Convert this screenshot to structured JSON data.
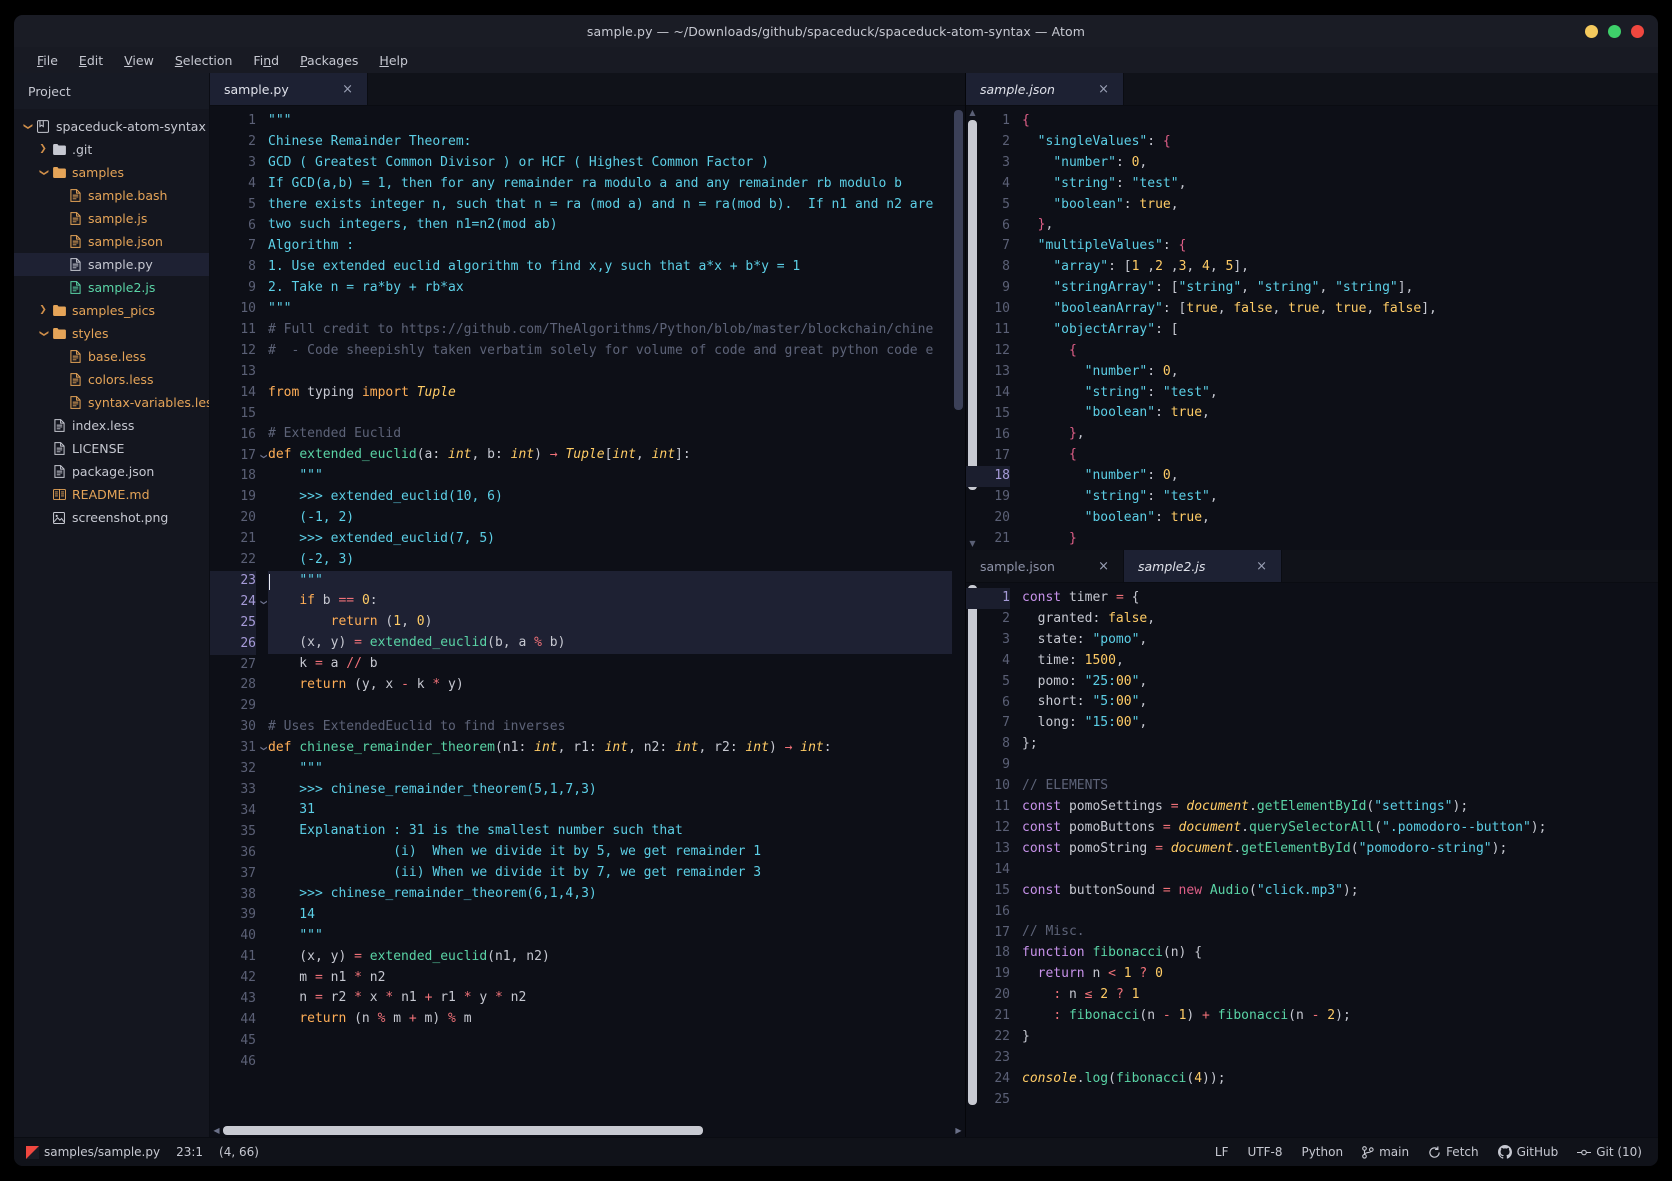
{
  "window": {
    "title": "sample.py — ~/Downloads/github/spaceduck/spaceduck-atom-syntax — Atom",
    "controls": {
      "minimize": "minimize",
      "maximize": "maximize",
      "close": "close"
    }
  },
  "menubar": {
    "items": [
      {
        "label": "File",
        "mnemonic": "F"
      },
      {
        "label": "Edit",
        "mnemonic": "E"
      },
      {
        "label": "View",
        "mnemonic": "V"
      },
      {
        "label": "Selection",
        "mnemonic": "S"
      },
      {
        "label": "Find",
        "mnemonic": "n"
      },
      {
        "label": "Packages",
        "mnemonic": "P"
      },
      {
        "label": "Help",
        "mnemonic": "H"
      }
    ]
  },
  "sidebar": {
    "header": "Project",
    "tree": [
      {
        "label": "spaceduck-atom-syntax",
        "depth": 0,
        "twisty": "v",
        "icon": "repo-icon",
        "color": "white",
        "selected": false
      },
      {
        "label": ".git",
        "depth": 1,
        "twisty": ">",
        "icon": "folder-icon",
        "color": "white",
        "selected": false
      },
      {
        "label": "samples",
        "depth": 1,
        "twisty": "v",
        "icon": "folder-icon",
        "color": "orange",
        "selected": false
      },
      {
        "label": "sample.bash",
        "depth": 2,
        "twisty": "",
        "icon": "file-icon",
        "color": "orange",
        "selected": false
      },
      {
        "label": "sample.js",
        "depth": 2,
        "twisty": "",
        "icon": "file-icon",
        "color": "orange",
        "selected": false
      },
      {
        "label": "sample.json",
        "depth": 2,
        "twisty": "",
        "icon": "file-icon",
        "color": "orange",
        "selected": false
      },
      {
        "label": "sample.py",
        "depth": 2,
        "twisty": "",
        "icon": "file-icon",
        "color": "white",
        "selected": true
      },
      {
        "label": "sample2.js",
        "depth": 2,
        "twisty": "",
        "icon": "file-icon",
        "color": "green",
        "selected": false
      },
      {
        "label": "samples_pics",
        "depth": 1,
        "twisty": ">",
        "icon": "folder-icon",
        "color": "orange",
        "selected": false
      },
      {
        "label": "styles",
        "depth": 1,
        "twisty": "v",
        "icon": "folder-icon",
        "color": "orange",
        "selected": false
      },
      {
        "label": "base.less",
        "depth": 2,
        "twisty": "",
        "icon": "file-icon",
        "color": "orange",
        "selected": false
      },
      {
        "label": "colors.less",
        "depth": 2,
        "twisty": "",
        "icon": "file-icon",
        "color": "orange",
        "selected": false
      },
      {
        "label": "syntax-variables.less",
        "depth": 2,
        "twisty": "",
        "icon": "file-icon",
        "color": "orange",
        "selected": false
      },
      {
        "label": "index.less",
        "depth": 1,
        "twisty": "",
        "icon": "file-icon",
        "color": "white",
        "selected": false
      },
      {
        "label": "LICENSE",
        "depth": 1,
        "twisty": "",
        "icon": "file-icon",
        "color": "white",
        "selected": false
      },
      {
        "label": "package.json",
        "depth": 1,
        "twisty": "",
        "icon": "file-icon",
        "color": "white",
        "selected": false
      },
      {
        "label": "README.md",
        "depth": 1,
        "twisty": "",
        "icon": "book-icon",
        "color": "orange",
        "selected": false
      },
      {
        "label": "screenshot.png",
        "depth": 1,
        "twisty": "",
        "icon": "image-icon",
        "color": "white",
        "selected": false
      }
    ]
  },
  "panes": {
    "left": {
      "tabs": [
        {
          "label": "sample.py",
          "active": true,
          "italic": false,
          "close": "×"
        }
      ],
      "first_line": 1,
      "lines": [
        "\"\"\"",
        "Chinese Remainder Theorem:",
        "GCD ( Greatest Common Divisor ) or HCF ( Highest Common Factor )",
        "If GCD(a,b) = 1, then for any remainder ra modulo a and any remainder rb modulo b",
        "there exists integer n, such that n = ra (mod a) and n = ra(mod b).  If n1 and n2 are",
        "two such integers, then n1=n2(mod ab)",
        "Algorithm :",
        "1. Use extended euclid algorithm to find x,y such that a*x + b*y = 1",
        "2. Take n = ra*by + rb*ax",
        "\"\"\"",
        "# Full credit to https://github.com/TheAlgorithms/Python/blob/master/blockchain/chine",
        "#  - Code sheepishly taken verbatim solely for volume of code and great python code e",
        "",
        "from typing import Tuple",
        "",
        "# Extended Euclid",
        "def extended_euclid(a: int, b: int) -> Tuple[int, int]:",
        "    \"\"\"",
        "    >>> extended_euclid(10, 6)",
        "    (-1, 2)",
        "    >>> extended_euclid(7, 5)",
        "    (-2, 3)",
        "    \"\"\"",
        "    if b == 0:",
        "        return (1, 0)",
        "    (x, y) = extended_euclid(b, a % b)",
        "    k = a // b",
        "    return (y, x - k * y)",
        "",
        "# Uses ExtendedEuclid to find inverses",
        "def chinese_remainder_theorem(n1: int, r1: int, n2: int, r2: int) -> int:",
        "    \"\"\"",
        "    >>> chinese_remainder_theorem(5,1,7,3)",
        "    31",
        "    Explanation : 31 is the smallest number such that",
        "                (i)  When we divide it by 5, we get remainder 1",
        "                (ii) When we divide it by 7, we get remainder 3",
        "    >>> chinese_remainder_theorem(6,1,4,3)",
        "    14",
        "    \"\"\"",
        "    (x, y) = extended_euclid(n1, n2)",
        "    m = n1 * n2",
        "    n = r2 * x * n1 + r1 * y * n2",
        "    return (n % m + m) % m",
        "",
        ""
      ],
      "selected_lines": [
        23,
        24,
        25,
        26
      ],
      "fold_lines": [
        17,
        24,
        31
      ]
    },
    "right_top": {
      "tabs": [
        {
          "label": "sample.json",
          "active": true,
          "italic": true,
          "close": "×"
        }
      ],
      "active_line": 18,
      "lines": [
        "{",
        "  \"singleValues\": {",
        "    \"number\": 0,",
        "    \"string\": \"test\",",
        "    \"boolean\": true,",
        "  },",
        "  \"multipleValues\": {",
        "    \"array\": [1 ,2 ,3, 4, 5],",
        "    \"stringArray\": [\"string\", \"string\", \"string\"],",
        "    \"booleanArray\": [true, false, true, true, false],",
        "    \"objectArray\": [",
        "      {",
        "        \"number\": 0,",
        "        \"string\": \"test\",",
        "        \"boolean\": true,",
        "      },",
        "      {",
        "        \"number\": 0,",
        "        \"string\": \"test\",",
        "        \"boolean\": true,",
        "      }"
      ]
    },
    "right_bottom": {
      "tabs": [
        {
          "label": "sample.json",
          "active": false,
          "italic": false,
          "close": "×"
        },
        {
          "label": "sample2.js",
          "active": true,
          "italic": true,
          "close": "×"
        }
      ],
      "active_line": 1,
      "lines": [
        "const timer = {",
        "  granted: false,",
        "  state: \"pomo\",",
        "  time: 1500,",
        "  pomo: \"25:00\",",
        "  short: \"5:00\",",
        "  long: \"15:00\",",
        "};",
        "",
        "// ELEMENTS",
        "const pomoSettings = document.getElementById(\"settings\");",
        "const pomoButtons = document.querySelectorAll(\".pomodoro--button\");",
        "const pomoString = document.getElementById(\"pomodoro-string\");",
        "",
        "const buttonSound = new Audio(\"click.mp3\");",
        "",
        "// Misc.",
        "function fibonacci(n) {",
        "  return n < 1 ? 0",
        "    : n <= 2 ? 1",
        "    : fibonacci(n - 1) + fibonacci(n - 2);",
        "}",
        "",
        "console.log(fibonacci(4));",
        ""
      ]
    }
  },
  "statusbar": {
    "file_path": "samples/sample.py",
    "cursor_position": "23:1",
    "selection_size": "(4, 66)",
    "line_ending": "LF",
    "encoding": "UTF-8",
    "grammar": "Python",
    "branch": "main",
    "fetch": "Fetch",
    "github": "GitHub",
    "git": "Git (10)"
  },
  "colors": {
    "accent": "#c792ea",
    "string": "#5ccfe6",
    "function": "#5ad4a6",
    "number": "#ffcc66",
    "comment": "#5d6378",
    "operator": "#f07178",
    "background": "#0d0f17",
    "panel": "#14161f"
  }
}
